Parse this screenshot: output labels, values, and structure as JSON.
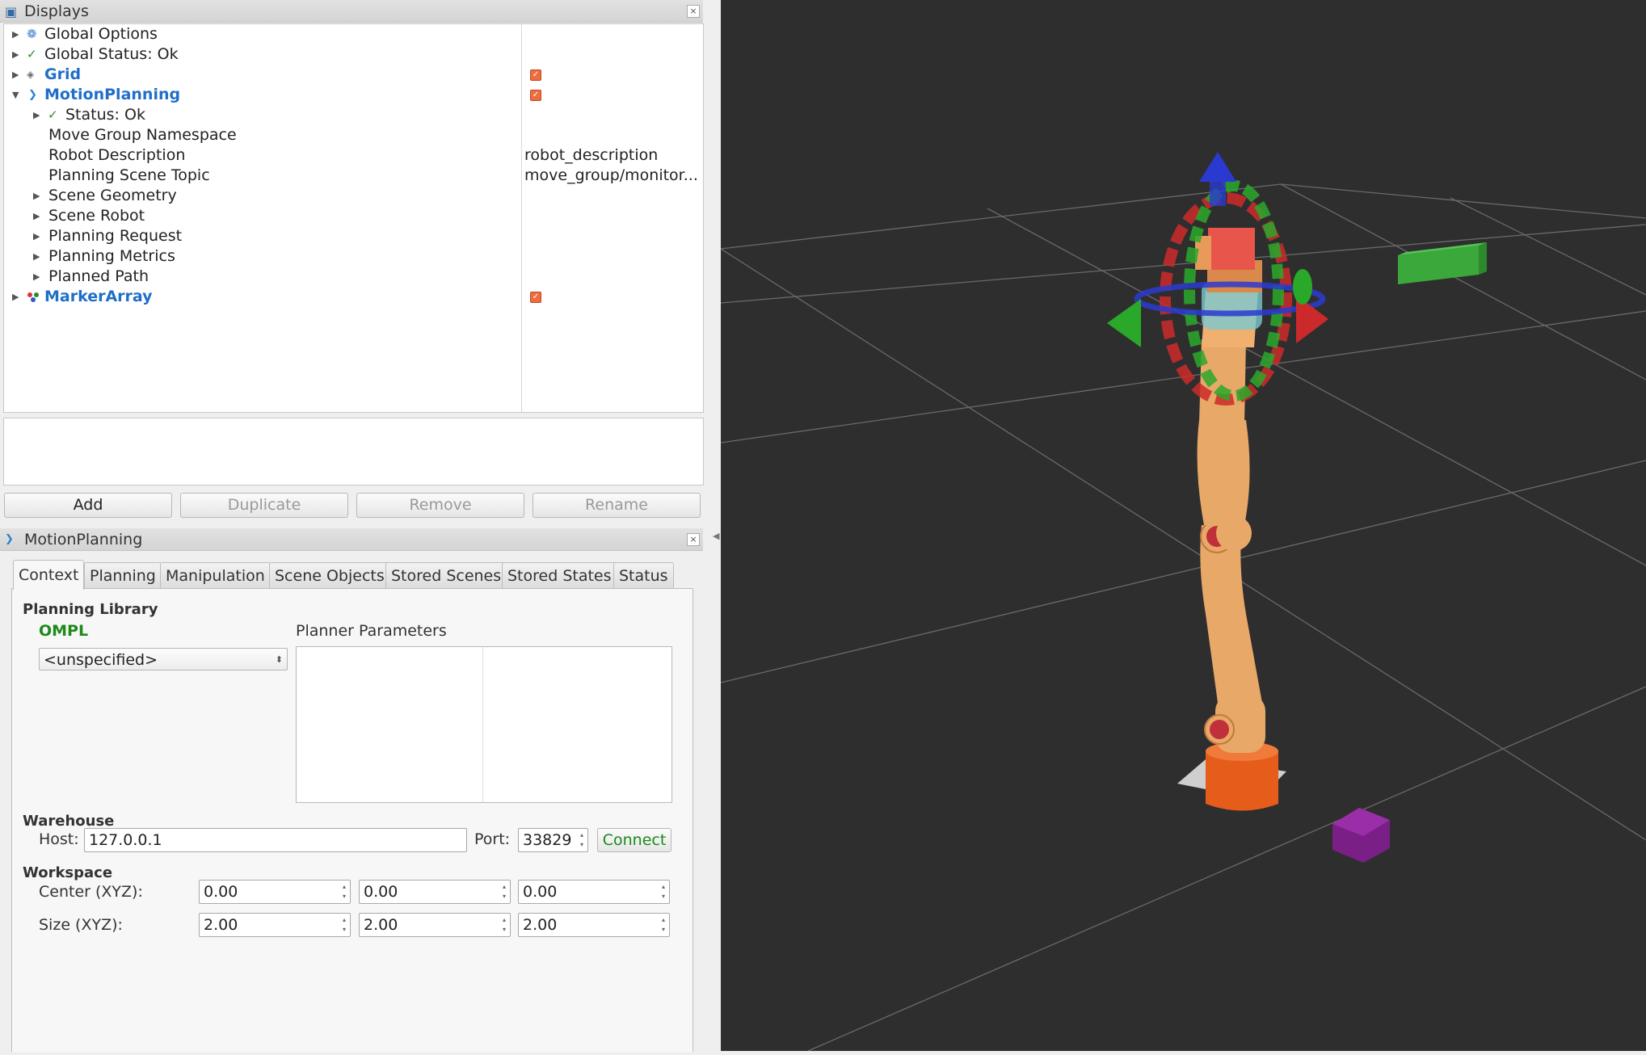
{
  "displays_panel": {
    "title": "Displays",
    "tree": [
      {
        "label": "Global Options",
        "expanded": false,
        "icon": "gear-icon"
      },
      {
        "label": "Global Status: Ok",
        "expanded": false,
        "icon": "check-icon"
      },
      {
        "label": "Grid",
        "expanded": false,
        "icon": "grid-icon",
        "checked": true
      },
      {
        "label": "MotionPlanning",
        "expanded": true,
        "icon": "motion-planning-icon",
        "checked": true
      },
      {
        "label": "Status: Ok",
        "icon": "check-icon"
      },
      {
        "label": "Move Group Namespace",
        "value": ""
      },
      {
        "label": "Robot Description",
        "value": "robot_description"
      },
      {
        "label": "Planning Scene Topic",
        "value": "move_group/monitor..."
      },
      {
        "label": "Scene Geometry"
      },
      {
        "label": "Scene Robot"
      },
      {
        "label": "Planning Request"
      },
      {
        "label": "Planning Metrics"
      },
      {
        "label": "Planned Path"
      },
      {
        "label": "MarkerArray",
        "icon": "marker-array-icon",
        "checked": true
      }
    ],
    "buttons": {
      "add": "Add",
      "duplicate": "Duplicate",
      "remove": "Remove",
      "rename": "Rename"
    }
  },
  "motion_panel": {
    "title": "MotionPlanning",
    "tabs": [
      "Context",
      "Planning",
      "Manipulation",
      "Scene Objects",
      "Stored Scenes",
      "Stored States",
      "Status"
    ],
    "active_tab": "Context",
    "planning_library": {
      "heading": "Planning Library",
      "library_name": "OMPL",
      "planner_select": "<unspecified>",
      "planner_params_label": "Planner Parameters"
    },
    "warehouse": {
      "heading": "Warehouse",
      "host_label": "Host:",
      "host_value": "127.0.0.1",
      "port_label": "Port:",
      "port_value": "33829",
      "connect_label": "Connect"
    },
    "workspace": {
      "heading": "Workspace",
      "center_label": "Center (XYZ):",
      "center": [
        "0.00",
        "0.00",
        "0.00"
      ],
      "size_label": "Size (XYZ):",
      "size": [
        "2.00",
        "2.00",
        "2.00"
      ]
    }
  },
  "colors": {
    "accent_blue": "#1f6fc9",
    "ompl_green": "#1a8a1a",
    "checkbox_orange": "#ef6c3c",
    "viewport_bg": "#2e2e2e",
    "robot_body": "#e8a868"
  }
}
